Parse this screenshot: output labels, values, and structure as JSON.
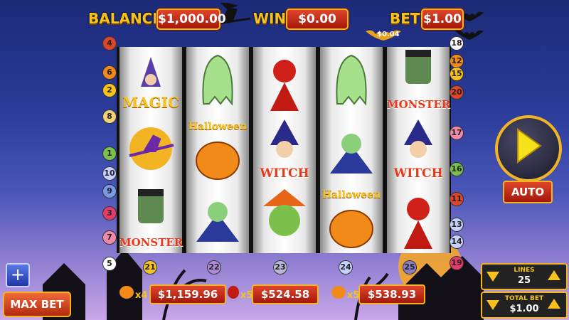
{
  "header": {
    "balance_label": "BALANCE",
    "balance_value": "$1,000.00",
    "win_label": "WIN",
    "win_value": "$0.00",
    "bet_label": "BET",
    "bet_value": "$1.00",
    "line_bet": "$0.04"
  },
  "reels": [
    [
      {
        "symbol": "wizard",
        "text": "MAGIC"
      },
      {
        "symbol": "witch-on-broom",
        "text": ""
      },
      {
        "symbol": "frankenstein",
        "text": "MONSTER"
      }
    ],
    [
      {
        "symbol": "ghost",
        "text": ""
      },
      {
        "symbol": "pumpkin",
        "text": "Halloween"
      },
      {
        "symbol": "vampire",
        "text": ""
      }
    ],
    [
      {
        "symbol": "devil",
        "text": ""
      },
      {
        "symbol": "witch",
        "text": "WITCH"
      },
      {
        "symbol": "scarecrow",
        "text": ""
      }
    ],
    [
      {
        "symbol": "ghost",
        "text": ""
      },
      {
        "symbol": "vampire",
        "text": ""
      },
      {
        "symbol": "pumpkin",
        "text": "Halloween"
      }
    ],
    [
      {
        "symbol": "frankenstein",
        "text": "MONSTER"
      },
      {
        "symbol": "witch",
        "text": "WITCH"
      },
      {
        "symbol": "devil",
        "text": ""
      }
    ]
  ],
  "left_markers": [
    "4",
    "6",
    "2",
    "8",
    "1",
    "10",
    "9",
    "3",
    "7",
    "5"
  ],
  "right_markers": [
    "18",
    "12",
    "15",
    "20",
    "17",
    "16",
    "11",
    "13",
    "14",
    "19"
  ],
  "bottom_markers": [
    "21",
    "22",
    "23",
    "24",
    "25"
  ],
  "bottom_wins": [
    {
      "count": "x4",
      "value": "$1,159.96",
      "icon": "pumpkin-icon"
    },
    {
      "count": "x5",
      "value": "$524.58",
      "icon": "devil-icon"
    },
    {
      "count": "x5",
      "value": "$538.93",
      "icon": "pumpkin-icon"
    }
  ],
  "controls": {
    "max_bet": "MAX BET",
    "plus": "+",
    "auto": "AUTO",
    "lines_label": "LINES",
    "lines_value": "25",
    "total_bet_label": "TOTAL BET",
    "total_bet_value": "$1.00"
  },
  "colors": {
    "accent": "#f6c21b",
    "button_red": "#c8301a",
    "frame_gold": "#f3b423"
  }
}
